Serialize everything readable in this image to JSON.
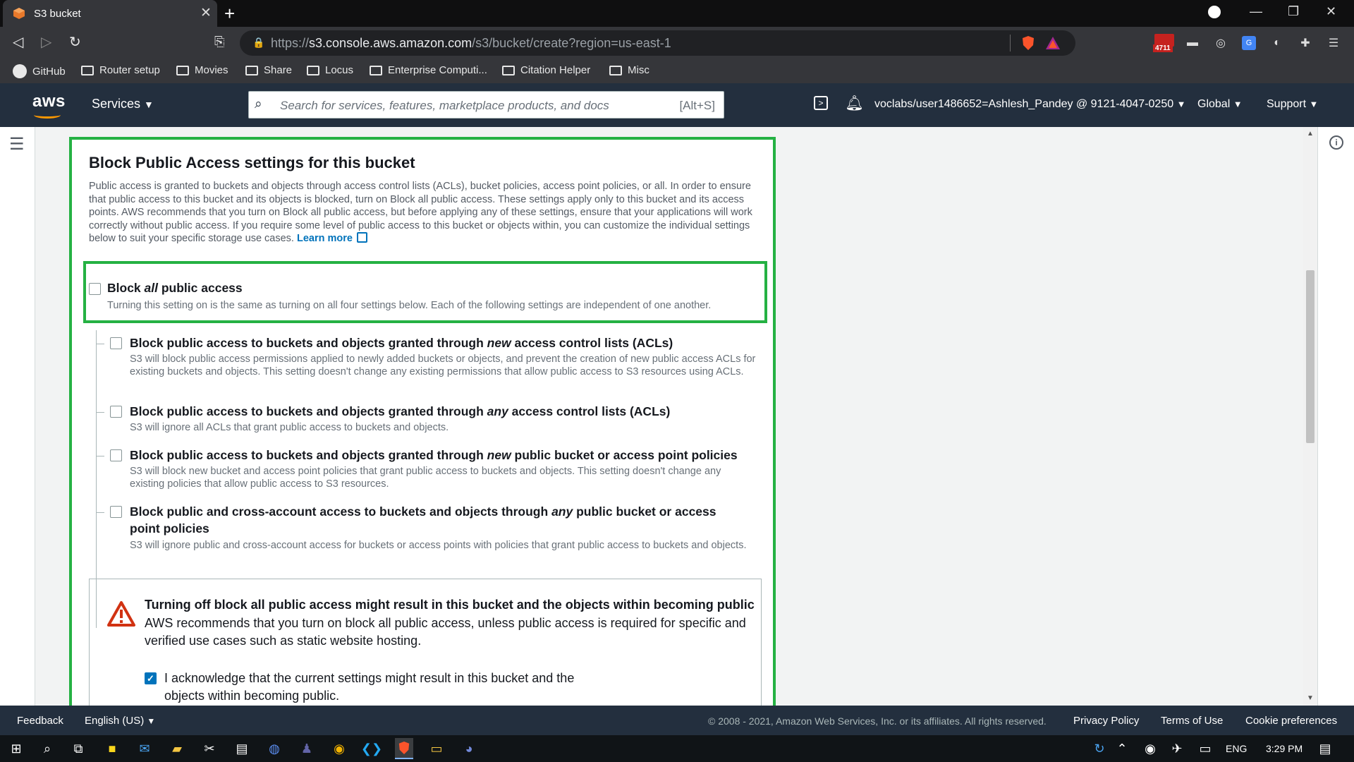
{
  "browser": {
    "tab_title": "S3 bucket",
    "url_prefix": "https://",
    "url_host": "s3.console.aws.amazon.com",
    "url_path": "/s3/bucket/create?region=us-east-1",
    "ext_badge": "4711",
    "bookmarks": [
      "GitHub",
      "Router setup",
      "Movies",
      "Share",
      "Locus",
      "Enterprise Computi...",
      "Citation Helper",
      "Misc"
    ]
  },
  "aws_nav": {
    "logo": "aws",
    "services": "Services",
    "search_placeholder": "Search for services, features, marketplace products, and docs",
    "search_shortcut": "[Alt+S]",
    "account": "voclabs/user1486652=Ashlesh_Pandey @ 9121-4047-0250",
    "region": "Global",
    "support": "Support"
  },
  "section": {
    "title": "Block Public Access settings for this bucket",
    "description": "Public access is granted to buckets and objects through access control lists (ACLs), bucket policies, access point policies, or all. In order to ensure that public access to this bucket and its objects is blocked, turn on Block all public access. These settings apply only to this bucket and its access points. AWS recommends that you turn on Block all public access, but before applying any of these settings, ensure that your applications will work correctly without public access. If you require some level of public access to this bucket or objects within, you can customize the individual settings below to suit your specific storage use cases.",
    "learn_more": "Learn more"
  },
  "block_all": {
    "title_pre": "Block ",
    "title_em": "all",
    "title_post": " public access",
    "description": "Turning this setting on is the same as turning on all four settings below. Each of the following settings are independent of one another.",
    "checked": false
  },
  "options": [
    {
      "title_pre": "Block public access to buckets and objects granted through ",
      "title_em": "new",
      "title_post": " access control lists (ACLs)",
      "description": "S3 will block public access permissions applied to newly added buckets or objects, and prevent the creation of new public access ACLs for existing buckets and objects. This setting doesn't change any existing permissions that allow public access to S3 resources using ACLs.",
      "checked": false
    },
    {
      "title_pre": "Block public access to buckets and objects granted through ",
      "title_em": "any",
      "title_post": " access control lists (ACLs)",
      "description": "S3 will ignore all ACLs that grant public access to buckets and objects.",
      "checked": false
    },
    {
      "title_pre": "Block public access to buckets and objects granted through ",
      "title_em": "new",
      "title_post": " public bucket or access point policies",
      "description": "S3 will block new bucket and access point policies that grant public access to buckets and objects. This setting doesn't change any existing policies that allow public access to S3 resources.",
      "checked": false
    },
    {
      "title_pre": "Block public and cross-account access to buckets and objects through ",
      "title_em": "any",
      "title_post": " public bucket or access point policies",
      "description": "S3 will ignore public and cross-account access for buckets or access points with policies that grant public access to buckets and objects.",
      "checked": false
    }
  ],
  "warning": {
    "title": "Turning off block all public access might result in this bucket and the objects within becoming public",
    "text": "AWS recommends that you turn on block all public access, unless public access is required for specific and verified use cases such as static website hosting.",
    "ack_label": "I acknowledge that the current settings might result in this bucket and the objects within becoming public.",
    "ack_checked": true
  },
  "footer": {
    "feedback": "Feedback",
    "language": "English (US)",
    "copyright": "© 2008 - 2021, Amazon Web Services, Inc. or its affiliates. All rights reserved.",
    "privacy": "Privacy Policy",
    "terms": "Terms of Use",
    "cookies": "Cookie preferences"
  },
  "taskbar": {
    "lang": "ENG",
    "time": "3:29 PM"
  },
  "colors": {
    "aws_navy": "#232f3e",
    "aws_orange": "#ff9900",
    "link_blue": "#0073bb",
    "highlight_green": "#25b143",
    "warning_red": "#d13212"
  }
}
